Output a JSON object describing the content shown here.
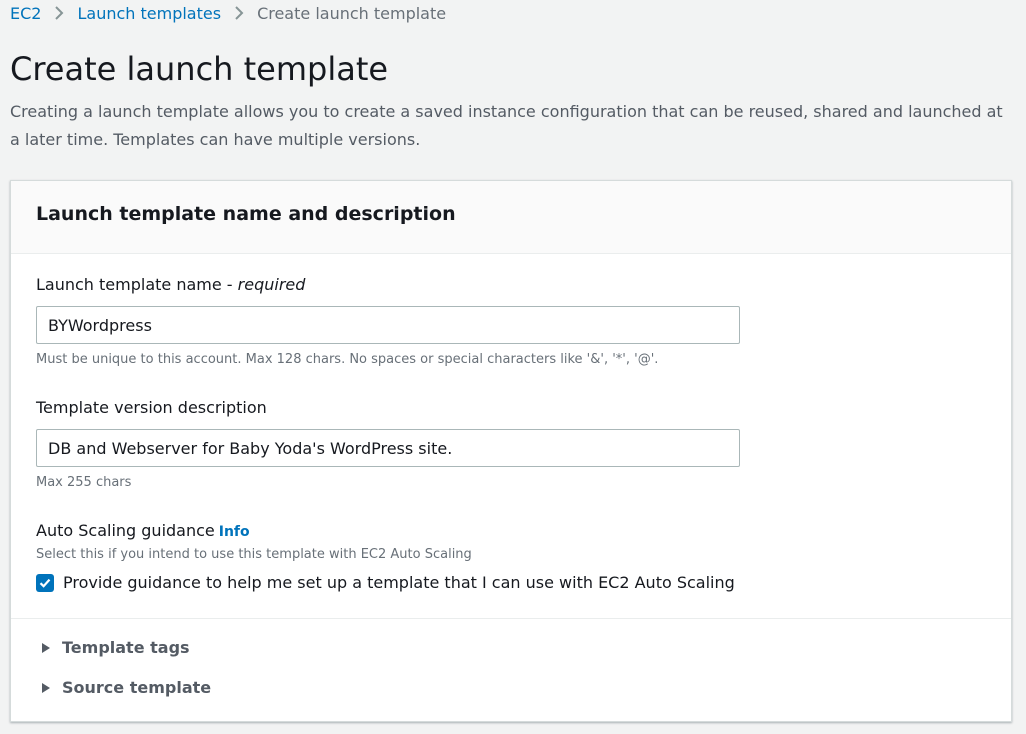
{
  "breadcrumb": {
    "items": [
      {
        "label": "EC2"
      },
      {
        "label": "Launch templates"
      },
      {
        "label": "Create launch template"
      }
    ]
  },
  "page": {
    "title": "Create launch template",
    "description": "Creating a launch template allows you to create a saved instance configuration that can be reused, shared and launched at a later time. Templates can have multiple versions."
  },
  "panel": {
    "title": "Launch template name and description",
    "name_field": {
      "label": "Launch template name - ",
      "required": "required",
      "value": "BYWordpress",
      "hint": "Must be unique to this account. Max 128 chars. No spaces or special characters like '&', '*', '@'."
    },
    "description_field": {
      "label": "Template version description",
      "value": "DB and Webserver for Baby Yoda's WordPress site.",
      "hint": "Max 255 chars"
    },
    "auto_scaling": {
      "label": "Auto Scaling guidance",
      "info": "Info",
      "hint": "Select this if you intend to use this template with EC2 Auto Scaling",
      "checkbox_label": "Provide guidance to help me set up a template that I can use with EC2 Auto Scaling",
      "checked": true
    },
    "sections": [
      {
        "label": "Template tags"
      },
      {
        "label": "Source template"
      }
    ]
  },
  "colors": {
    "link": "#0073bb",
    "background": "#f2f3f3",
    "panel_header": "#fafafa",
    "checkbox": "#0073bb"
  }
}
